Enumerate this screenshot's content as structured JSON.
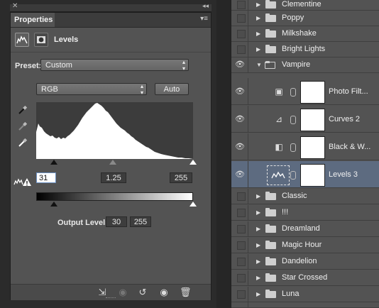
{
  "properties": {
    "tab_label": "Properties",
    "header_title": "Levels",
    "preset_label": "Preset:",
    "preset_value": "Custom",
    "channel_value": "RGB",
    "auto_label": "Auto",
    "input_levels": {
      "black": "31",
      "gamma": "1.25",
      "white": "255"
    },
    "output_levels_label": "Output Levels:",
    "output_levels": {
      "black": "30",
      "white": "255"
    }
  },
  "layers": [
    {
      "name": "Clementine",
      "kind": "group"
    },
    {
      "name": "Poppy",
      "kind": "group"
    },
    {
      "name": "Milkshake",
      "kind": "group"
    },
    {
      "name": "Bright Lights",
      "kind": "group"
    },
    {
      "name": "Vampire",
      "kind": "group-open",
      "visible": true
    },
    {
      "name": "Photo Filt...",
      "kind": "adjustment",
      "icon": "camera-icon",
      "visible": true
    },
    {
      "name": "Curves 2",
      "kind": "adjustment",
      "icon": "curves-icon",
      "visible": true
    },
    {
      "name": "Black & W...",
      "kind": "adjustment",
      "icon": "black-white-icon",
      "visible": true
    },
    {
      "name": "Levels 3",
      "kind": "adjustment",
      "icon": "levels-icon",
      "visible": true,
      "selected": true
    },
    {
      "name": "Classic",
      "kind": "group"
    },
    {
      "name": "!!!",
      "kind": "group"
    },
    {
      "name": "Dreamland",
      "kind": "group"
    },
    {
      "name": "Magic Hour",
      "kind": "group"
    },
    {
      "name": "Dandelion",
      "kind": "group"
    },
    {
      "name": "Star Crossed",
      "kind": "group"
    },
    {
      "name": "Luna",
      "kind": "group"
    }
  ]
}
